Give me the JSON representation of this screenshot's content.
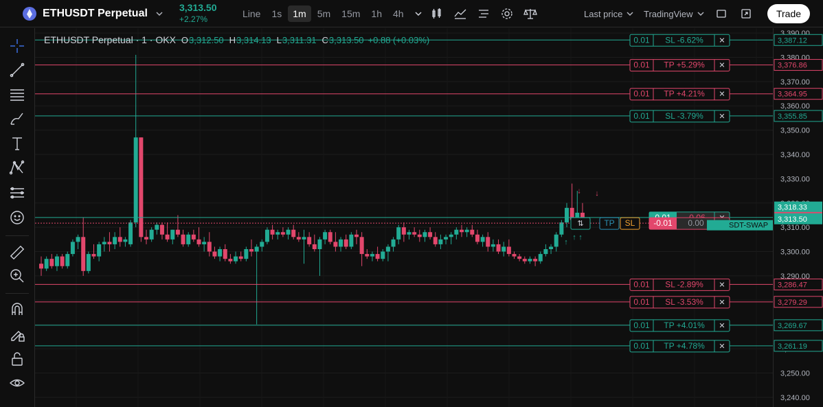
{
  "header": {
    "symbol": "ETHUSDT Perpetual",
    "last_price": "3,313.50",
    "change_pct": "+2.27%",
    "intervals": [
      "Line",
      "1s",
      "1m",
      "5m",
      "15m",
      "1h",
      "4h"
    ],
    "active_interval": "1m",
    "price_mode": "Last price",
    "price_source": "TradingView",
    "trade_label": "Trade"
  },
  "legend": {
    "title": "ETHUSDT Perpetual · 1 · OKX",
    "o_label": "O",
    "o": "3,312.50",
    "h_label": "H",
    "h": "3,314.13",
    "l_label": "L",
    "l": "3,311.31",
    "c_label": "C",
    "c": "3,313.50",
    "change": "+0.88 (+0.03%)"
  },
  "colors": {
    "up": "#22ab94",
    "down": "#e2476c",
    "bg": "#0f0f0f",
    "green_line": "#22ab94",
    "red_line": "#e2476c"
  },
  "price_axis": {
    "ticks": [
      "3,390.00",
      "3,380.00",
      "3,370.00",
      "3,360.00",
      "3,350.00",
      "3,340.00",
      "3,330.00",
      "3,320.00",
      "3,310.00",
      "3,300.00",
      "3,290.00",
      "3,280.00",
      "3,270.00",
      "3,260.00",
      "3,250.00",
      "3,240.00"
    ],
    "tick_values": [
      3390,
      3380,
      3370,
      3360,
      3350,
      3340,
      3330,
      3320,
      3310,
      3300,
      3290,
      3280,
      3270,
      3260,
      3250,
      3240
    ]
  },
  "orders": [
    {
      "qty": "0.01",
      "label": "SL -6.62%",
      "price": "3,387.12",
      "value": 3387.12,
      "color": "green"
    },
    {
      "qty": "0.01",
      "label": "TP +5.29%",
      "price": "3,376.86",
      "value": 3376.86,
      "color": "red"
    },
    {
      "qty": "0.01",
      "label": "TP +4.21%",
      "price": "3,364.95",
      "value": 3364.95,
      "color": "red"
    },
    {
      "qty": "0.01",
      "label": "SL -3.79%",
      "price": "3,355.85",
      "value": 3355.85,
      "color": "green"
    },
    {
      "qty": "0.01",
      "label": "SL -2.89%",
      "price": "3,286.47",
      "value": 3286.47,
      "color": "red"
    },
    {
      "qty": "0.01",
      "label": "SL -3.53%",
      "price": "3,279.29",
      "value": 3279.29,
      "color": "red"
    },
    {
      "qty": "0.01",
      "label": "TP +4.01%",
      "price": "3,269.67",
      "value": 3269.67,
      "color": "green"
    },
    {
      "qty": "0.01",
      "label": "TP +4.78%",
      "price": "3,261.19",
      "value": 3261.19,
      "color": "green"
    }
  ],
  "positions": [
    {
      "qty": "0.01",
      "pnl": "-0.06",
      "price": "3,314.05",
      "value": 3314.05,
      "color": "green"
    },
    {
      "qty": "-0.01",
      "pnl": "0.00",
      "value": 3311.7,
      "color": "red"
    }
  ],
  "price_tags": [
    {
      "price": "3,318.33",
      "value": 3318.33,
      "color": "green"
    },
    {
      "price": "3,314.05",
      "value": 3314.05,
      "color": "red"
    },
    {
      "price": "3,313.50",
      "value": 3313.5,
      "color": "green"
    }
  ],
  "swap_label": "SDT-SWAP",
  "tp_label": "TP",
  "sl_label": "SL",
  "close_glyph": "✕",
  "chart_data": {
    "type": "candlestick",
    "ylim": [
      3236,
      3392
    ],
    "candles": [
      [
        3295,
        3298,
        3290,
        3293
      ],
      [
        3293,
        3298,
        3292,
        3297
      ],
      [
        3297,
        3299,
        3293,
        3294
      ],
      [
        3294,
        3299,
        3292,
        3298
      ],
      [
        3298,
        3299,
        3293,
        3294
      ],
      [
        3294,
        3300,
        3293,
        3299
      ],
      [
        3299,
        3305,
        3298,
        3304
      ],
      [
        3304,
        3307,
        3301,
        3306
      ],
      [
        3306,
        3314,
        3290,
        3292
      ],
      [
        3292,
        3300,
        3291,
        3299
      ],
      [
        3299,
        3303,
        3297,
        3298
      ],
      [
        3298,
        3304,
        3296,
        3303
      ],
      [
        3303,
        3306,
        3300,
        3304
      ],
      [
        3304,
        3308,
        3300,
        3303
      ],
      [
        3303,
        3308,
        3301,
        3306
      ],
      [
        3306,
        3310,
        3302,
        3304
      ],
      [
        3304,
        3306,
        3302,
        3305
      ],
      [
        3303,
        3313,
        3302,
        3312
      ],
      [
        3312,
        3381,
        3310,
        3347
      ],
      [
        3347,
        3347,
        3304,
        3306
      ],
      [
        3306,
        3309,
        3303,
        3305
      ],
      [
        3305,
        3310,
        3304,
        3309
      ],
      [
        3309,
        3312,
        3307,
        3311
      ],
      [
        3311,
        3312,
        3305,
        3307
      ],
      [
        3307,
        3312,
        3304,
        3305
      ],
      [
        3305,
        3309,
        3303,
        3309
      ],
      [
        3309,
        3315,
        3306,
        3307
      ],
      [
        3307,
        3309,
        3302,
        3303
      ],
      [
        3303,
        3308,
        3302,
        3307
      ],
      [
        3307,
        3309,
        3304,
        3305
      ],
      [
        3305,
        3310,
        3302,
        3303
      ],
      [
        3303,
        3306,
        3300,
        3304
      ],
      [
        3304,
        3308,
        3298,
        3300
      ],
      [
        3300,
        3302,
        3297,
        3298
      ],
      [
        3298,
        3302,
        3296,
        3301
      ],
      [
        3301,
        3303,
        3296,
        3297
      ],
      [
        3297,
        3299,
        3295,
        3296
      ],
      [
        3296,
        3300,
        3295,
        3298
      ],
      [
        3298,
        3300,
        3296,
        3297
      ],
      [
        3297,
        3302,
        3296,
        3301
      ],
      [
        3301,
        3305,
        3298,
        3300
      ],
      [
        3300,
        3303,
        3270,
        3302
      ],
      [
        3302,
        3305,
        3300,
        3304
      ],
      [
        3304,
        3310,
        3303,
        3309
      ],
      [
        3309,
        3311,
        3305,
        3307
      ],
      [
        3307,
        3309,
        3305,
        3308
      ],
      [
        3308,
        3310,
        3306,
        3307
      ],
      [
        3307,
        3310,
        3305,
        3309
      ],
      [
        3309,
        3311,
        3305,
        3306
      ],
      [
        3306,
        3308,
        3304,
        3305
      ],
      [
        3305,
        3309,
        3295,
        3306
      ],
      [
        3306,
        3308,
        3302,
        3303
      ],
      [
        3303,
        3307,
        3300,
        3301
      ],
      [
        3301,
        3306,
        3290,
        3305
      ],
      [
        3305,
        3309,
        3303,
        3308
      ],
      [
        3308,
        3309,
        3303,
        3304
      ],
      [
        3304,
        3308,
        3300,
        3302
      ],
      [
        3302,
        3306,
        3300,
        3305
      ],
      [
        3305,
        3307,
        3301,
        3302
      ],
      [
        3302,
        3308,
        3301,
        3307
      ],
      [
        3307,
        3309,
        3303,
        3306
      ],
      [
        3306,
        3308,
        3294,
        3299
      ],
      [
        3299,
        3301,
        3297,
        3298
      ],
      [
        3298,
        3300,
        3296,
        3299
      ],
      [
        3299,
        3302,
        3296,
        3297
      ],
      [
        3297,
        3301,
        3296,
        3300
      ],
      [
        3300,
        3303,
        3296,
        3302
      ],
      [
        3302,
        3306,
        3300,
        3305
      ],
      [
        3305,
        3311,
        3303,
        3310
      ],
      [
        3310,
        3312,
        3304,
        3307
      ],
      [
        3307,
        3309,
        3305,
        3308
      ],
      [
        3308,
        3310,
        3306,
        3307
      ],
      [
        3307,
        3309,
        3304,
        3306
      ],
      [
        3306,
        3309,
        3304,
        3308
      ],
      [
        3308,
        3310,
        3305,
        3306
      ],
      [
        3306,
        3308,
        3302,
        3303
      ],
      [
        3303,
        3307,
        3301,
        3305
      ],
      [
        3305,
        3307,
        3303,
        3306
      ],
      [
        3306,
        3308,
        3303,
        3307
      ],
      [
        3307,
        3310,
        3305,
        3309
      ],
      [
        3309,
        3311,
        3306,
        3308
      ],
      [
        3308,
        3310,
        3306,
        3309
      ],
      [
        3309,
        3311,
        3306,
        3307
      ],
      [
        3307,
        3309,
        3303,
        3304
      ],
      [
        3304,
        3307,
        3302,
        3306
      ],
      [
        3306,
        3308,
        3300,
        3302
      ],
      [
        3302,
        3305,
        3300,
        3303
      ],
      [
        3303,
        3305,
        3299,
        3300
      ],
      [
        3300,
        3304,
        3298,
        3302
      ],
      [
        3302,
        3305,
        3298,
        3299
      ],
      [
        3299,
        3300,
        3297,
        3298
      ],
      [
        3298,
        3299,
        3296,
        3297
      ],
      [
        3297,
        3298,
        3295,
        3296
      ],
      [
        3296,
        3298,
        3295,
        3297
      ],
      [
        3297,
        3298,
        3294,
        3296
      ],
      [
        3296,
        3300,
        3295,
        3299
      ],
      [
        3299,
        3303,
        3298,
        3301
      ],
      [
        3301,
        3303,
        3299,
        3302
      ],
      [
        3302,
        3308,
        3300,
        3307
      ],
      [
        3307,
        3313,
        3306,
        3312
      ],
      [
        3312,
        3320,
        3310,
        3318
      ],
      [
        3318,
        3328,
        3313,
        3313
      ],
      [
        3313,
        3325,
        3312,
        3316
      ],
      [
        3316,
        3320,
        3310,
        3313.5
      ]
    ]
  }
}
